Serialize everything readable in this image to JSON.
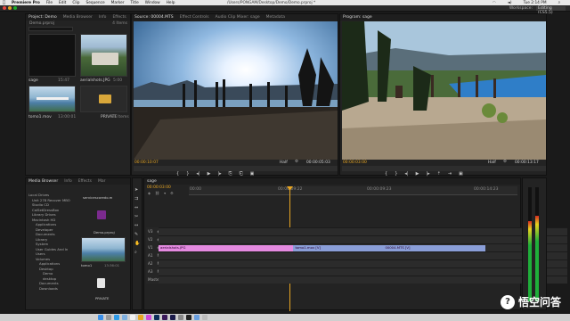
{
  "menubar": {
    "app": "Premiere Pro",
    "items": [
      "File",
      "Edit",
      "Clip",
      "Sequence",
      "Marker",
      "Title",
      "Window",
      "Help"
    ],
    "path": "/Users/PONGAM/Desktop/Demo/Demo.prproj *",
    "clock": "Tue 2:14 PM"
  },
  "workspace": {
    "label": "Workspace:",
    "value": "Editing (CS5.5)"
  },
  "project": {
    "tabs": [
      "Project: Demo",
      "Media Browser",
      "Info",
      "Effects"
    ],
    "file": "Demo.prproj",
    "items_count": "4 Items",
    "clips": [
      {
        "name": "sage",
        "duration": "15:47"
      },
      {
        "name": "aerialshots.JPG",
        "duration": "5:00"
      },
      {
        "name": "tomo1.mov",
        "duration": "13:00:01"
      },
      {
        "name": "PRIVATE",
        "duration": "37 Items"
      }
    ]
  },
  "source": {
    "tabs": [
      "Source: 00004.MTS",
      "Effect Controls",
      "Audio Clip Mixer: sage",
      "Metadata"
    ],
    "timecode": "00:00:10:07",
    "fit": "Half",
    "duration": "00:00:05:03"
  },
  "program": {
    "tabs": [
      "Program: sage"
    ],
    "timecode": "00:00:03:00",
    "fit": "Half",
    "duration": "00:00:13:17"
  },
  "mediabrowser": {
    "tabs": [
      "Media Browser",
      "Info",
      "Effects",
      "Mar"
    ],
    "tree": [
      "Local Drives",
      "Unit 278 Recover MBO",
      "Studio CD",
      "CalSetDressBox",
      "Library Drives",
      "Macintosh HD",
      "Applications",
      "Developer",
      "Documents",
      "Library",
      "System",
      "User Guides And In",
      "Users",
      "Volumes",
      "Applications",
      "Desktop",
      "Demo",
      "desktop",
      "Documents",
      "Downloads"
    ],
    "thumbs": [
      {
        "name": "servicescoredo.m"
      },
      {
        "name": "Demo.prproj"
      },
      {
        "name": "tomo1",
        "duration": "13:36:01"
      },
      {
        "name": "PRIVATE"
      }
    ]
  },
  "timeline": {
    "tabs": [
      "sage"
    ],
    "timecode": "00:00:03:00",
    "ruler": [
      "00:00",
      "00:00:09:22",
      "00:00:09:23",
      "00:00:14:23"
    ],
    "tracks": [
      "V3",
      "V2",
      "V1",
      "A1",
      "A2",
      "A3",
      "Master"
    ],
    "master_value": "0.0",
    "clips": [
      {
        "track": "V1",
        "label": "aerialshots.JPG",
        "start": 0.0,
        "end": 0.33
      },
      {
        "track": "V1",
        "label": "tomo1.mov [V]",
        "start": 0.33,
        "end": 0.55
      },
      {
        "track": "V1",
        "label": "00004.MTS [V]",
        "start": 0.55,
        "end": 0.8
      }
    ],
    "playhead": 0.33
  },
  "watermark": {
    "text": "悟空问答"
  },
  "colors": {
    "accent": "#e8a623",
    "clip_pink": "#e48ae0",
    "clip_blue": "#8a9ed8",
    "meter_green": "#1fae3a"
  }
}
